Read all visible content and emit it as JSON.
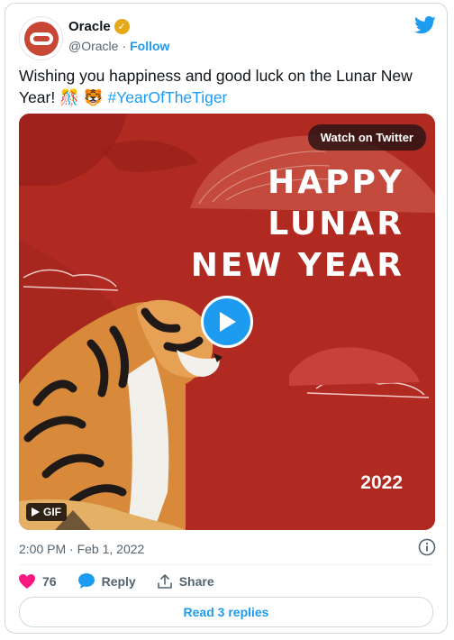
{
  "author": {
    "display_name": "Oracle",
    "verified_glyph": "✓",
    "handle": "@Oracle",
    "separator": "·",
    "follow_label": "Follow"
  },
  "tweet": {
    "text_before": "Wishing you happiness and good luck on the Lunar New Year!",
    "emojis": "🎊 🐯",
    "hashtag": "#YearOfTheTiger"
  },
  "media": {
    "watch_label": "Watch on Twitter",
    "headline": [
      "HAPPY",
      "LUNAR",
      "NEW YEAR"
    ],
    "year": "2022",
    "gif_label": "GIF"
  },
  "meta": {
    "timestamp": "2:00 PM · Feb 1, 2022"
  },
  "actions": {
    "likes": "76",
    "reply_label": "Reply",
    "share_label": "Share",
    "read_replies_label": "Read 3 replies"
  },
  "colors": {
    "accent": "#1d9bf0",
    "like": "#f91880",
    "background_red": "#b02a22",
    "brand_red": "#c74634"
  }
}
